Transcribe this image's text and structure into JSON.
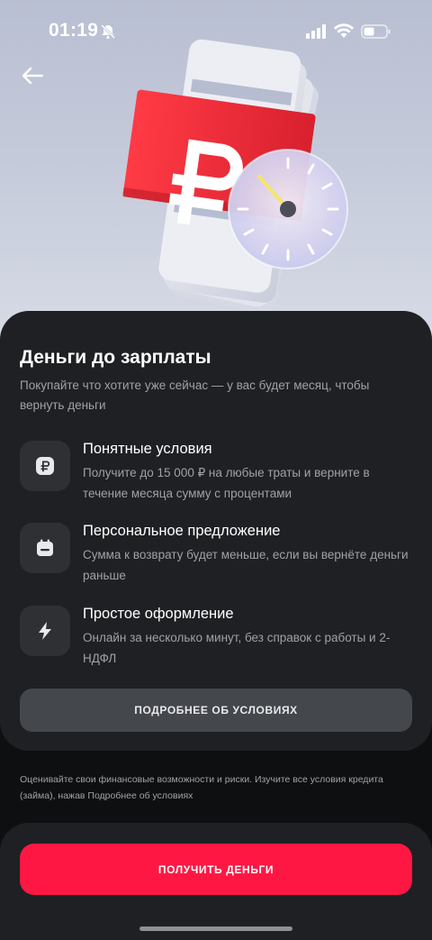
{
  "status_bar": {
    "time": "01:19",
    "icons": [
      "mute-bell-icon",
      "cellular-signal-icon",
      "wifi-icon",
      "battery-icon"
    ]
  },
  "nav": {
    "back_icon": "arrow-left-icon"
  },
  "hero": {
    "illustration": "ruble-banknotes-with-speedometer",
    "accent_color": "#ee2b3a"
  },
  "card": {
    "title": "Деньги до зарплаты",
    "subtitle": "Покупайте что хотите уже сейчас — у вас будет месяц, чтобы вернуть деньги",
    "features": [
      {
        "icon": "ruble-icon",
        "title": "Понятные условия",
        "description": "Получите до 15 000 ₽ на любые траты и верните в течение месяца сумму с процентами"
      },
      {
        "icon": "calendar-icon",
        "title": "Персональное предложение",
        "description": "Сумма к возврату будет меньше, если вы вернёте деньги раньше"
      },
      {
        "icon": "lightning-icon",
        "title": "Простое оформление",
        "description": "Онлайн за несколько минут, без справок с работы и 2-НДФЛ"
      }
    ],
    "details_button": "ПОДРОБНЕЕ ОБ УСЛОВИЯХ"
  },
  "disclaimer": "Оценивайте свои финансовые возможности и риски. Изучите все условия кредита (займа), нажав Подробнее об условиях",
  "cta": {
    "label": "ПОЛУЧИТЬ ДЕНЬГИ",
    "color": "#ff1744"
  }
}
